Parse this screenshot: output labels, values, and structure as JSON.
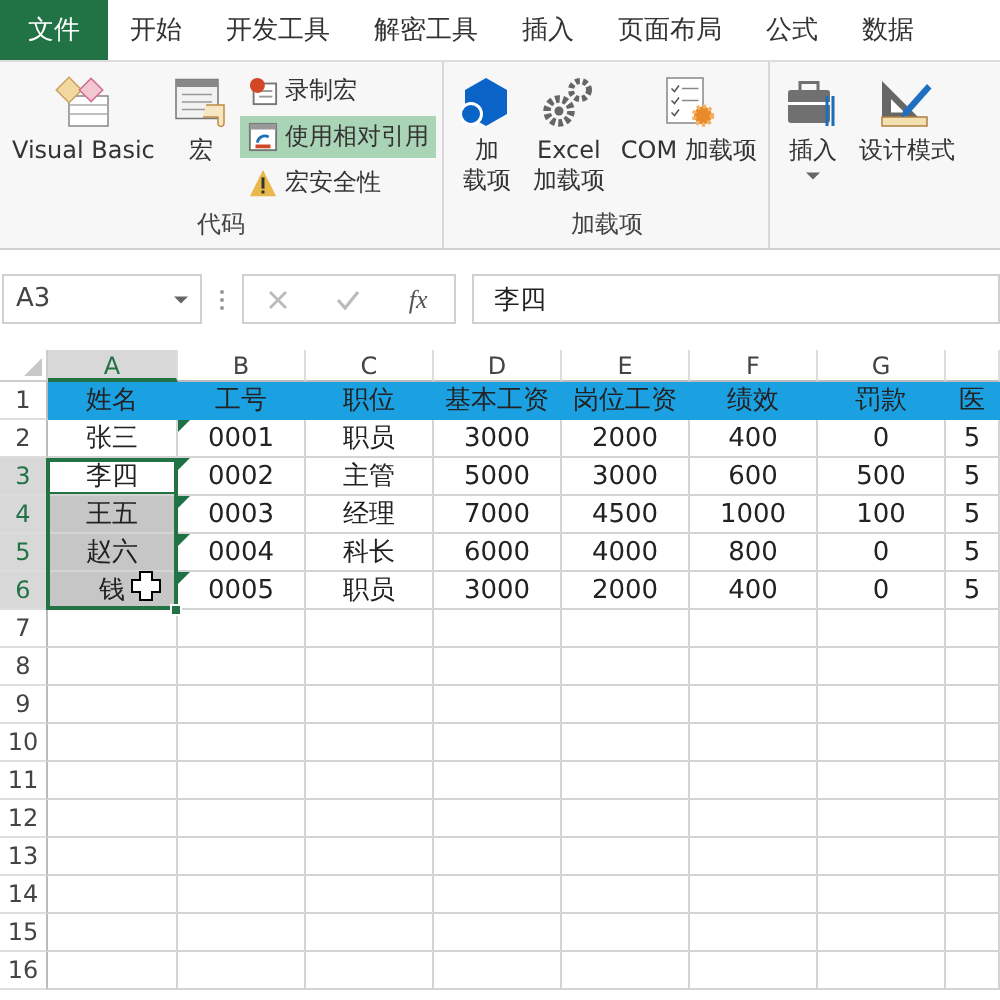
{
  "menu_tabs": [
    {
      "label": "文件",
      "selected": true
    },
    {
      "label": "开始",
      "selected": false
    },
    {
      "label": "开发工具",
      "selected": false
    },
    {
      "label": "解密工具",
      "selected": false
    },
    {
      "label": "插入",
      "selected": false
    },
    {
      "label": "页面布局",
      "selected": false
    },
    {
      "label": "公式",
      "selected": false
    },
    {
      "label": "数据",
      "selected": false
    }
  ],
  "ribbon_groups": [
    {
      "label": "代码",
      "items": [
        {
          "kind": "large",
          "lines": [
            "Visual Basic"
          ]
        },
        {
          "kind": "large",
          "lines": [
            "宏"
          ]
        },
        {
          "kind": "stack",
          "items": [
            {
              "label": "录制宏",
              "on": false
            },
            {
              "label": "使用相对引用",
              "on": true
            },
            {
              "label": "宏安全性",
              "on": false
            }
          ]
        }
      ]
    },
    {
      "label": "加载项",
      "items": [
        {
          "kind": "large",
          "lines": [
            "加",
            "载项"
          ]
        },
        {
          "kind": "large",
          "lines": [
            "Excel",
            "加载项"
          ]
        },
        {
          "kind": "large",
          "lines": [
            "COM 加载项"
          ]
        }
      ]
    },
    {
      "items": [
        {
          "kind": "large",
          "lines": [
            "插入"
          ],
          "dropdown": true
        },
        {
          "kind": "large",
          "lines": [
            "设计模式"
          ]
        }
      ]
    }
  ],
  "formula_bar": {
    "name_box": "A3",
    "fx": "fx",
    "value": "李四"
  },
  "columns": [
    "A",
    "B",
    "C",
    "D",
    "E",
    "F",
    "G"
  ],
  "rows": [
    {
      "number": "1",
      "kind": "header",
      "selected": false,
      "cells": [
        "姓名",
        "工号",
        "职位",
        "基本工资",
        "岗位工资",
        "绩效",
        "罚款",
        "医"
      ]
    },
    {
      "number": "2",
      "kind": "data",
      "selected": false,
      "flag": true,
      "cells": [
        "张三",
        "0001",
        "职员",
        "3000",
        "2000",
        "400",
        "0",
        "5"
      ]
    },
    {
      "number": "3",
      "kind": "data",
      "selected": true,
      "active": true,
      "flag": true,
      "cells": [
        "李四",
        "0002",
        "主管",
        "5000",
        "3000",
        "600",
        "500",
        "5"
      ]
    },
    {
      "number": "4",
      "kind": "data",
      "selected": true,
      "active": false,
      "flag": true,
      "cells": [
        "王五",
        "0003",
        "经理",
        "7000",
        "4500",
        "1000",
        "100",
        "5"
      ]
    },
    {
      "number": "5",
      "kind": "data",
      "selected": true,
      "active": false,
      "flag": true,
      "cells": [
        "赵六",
        "0004",
        "科长",
        "6000",
        "4000",
        "800",
        "0",
        "5"
      ]
    },
    {
      "number": "6",
      "kind": "data",
      "selected": true,
      "active": false,
      "flag": true,
      "cells": [
        "钱",
        "0005",
        "职员",
        "3000",
        "2000",
        "400",
        "0",
        "5"
      ]
    },
    {
      "number": "7"
    },
    {
      "number": "8"
    },
    {
      "number": "9"
    },
    {
      "number": "10"
    },
    {
      "number": "11"
    },
    {
      "number": "12"
    },
    {
      "number": "13"
    },
    {
      "number": "14"
    },
    {
      "number": "15"
    },
    {
      "number": "16"
    }
  ]
}
